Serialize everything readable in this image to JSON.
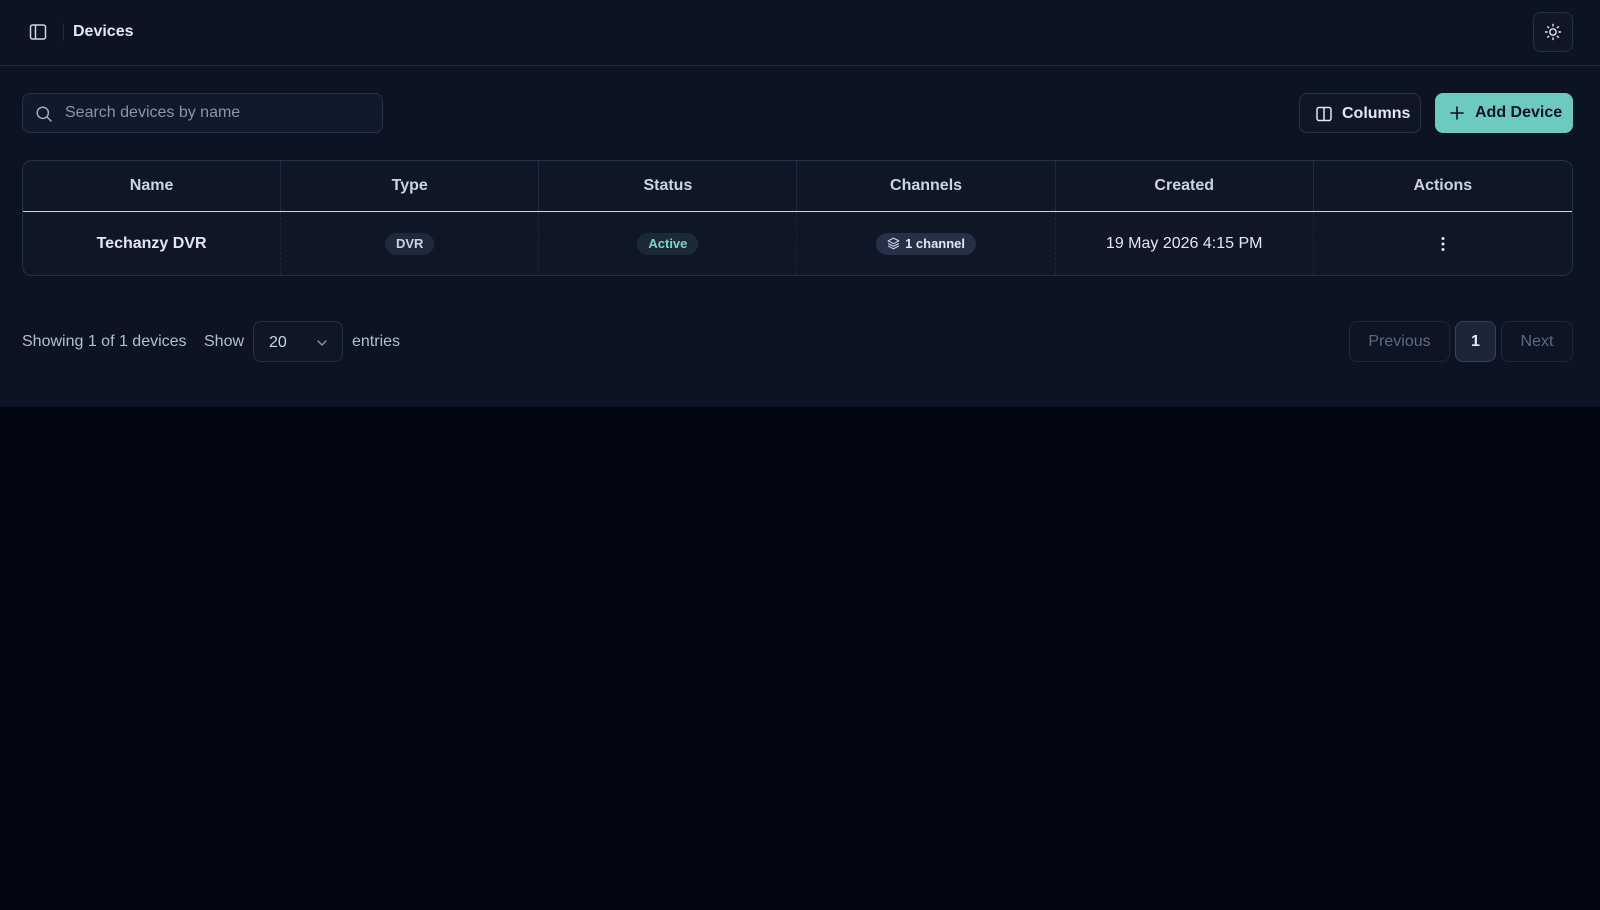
{
  "header": {
    "title": "Devices",
    "sidebar_toggle_icon": "sidebar-panel-icon",
    "theme_icon": "sun-icon"
  },
  "toolbar": {
    "search": {
      "placeholder": "Search devices by name",
      "value": ""
    },
    "columns_label": "Columns",
    "add_label": "Add Device"
  },
  "table": {
    "columns": [
      "Name",
      "Type",
      "Status",
      "Channels",
      "Created",
      "Actions"
    ],
    "rows": [
      {
        "name": "Techanzy DVR",
        "type": "DVR",
        "status": "Active",
        "channels": "1 channel",
        "created": "19 May 2026 4:15 PM"
      }
    ]
  },
  "footer": {
    "summary": "Showing 1 of 1 devices",
    "show_label": "Show",
    "page_size": "20",
    "entries_label": "entries",
    "prev_label": "Previous",
    "current_page": "1",
    "next_label": "Next"
  },
  "colors": {
    "background": "#020611",
    "panel": "#0c1322",
    "accent": "#6dcabf",
    "status_active": "#7fd3c6"
  }
}
